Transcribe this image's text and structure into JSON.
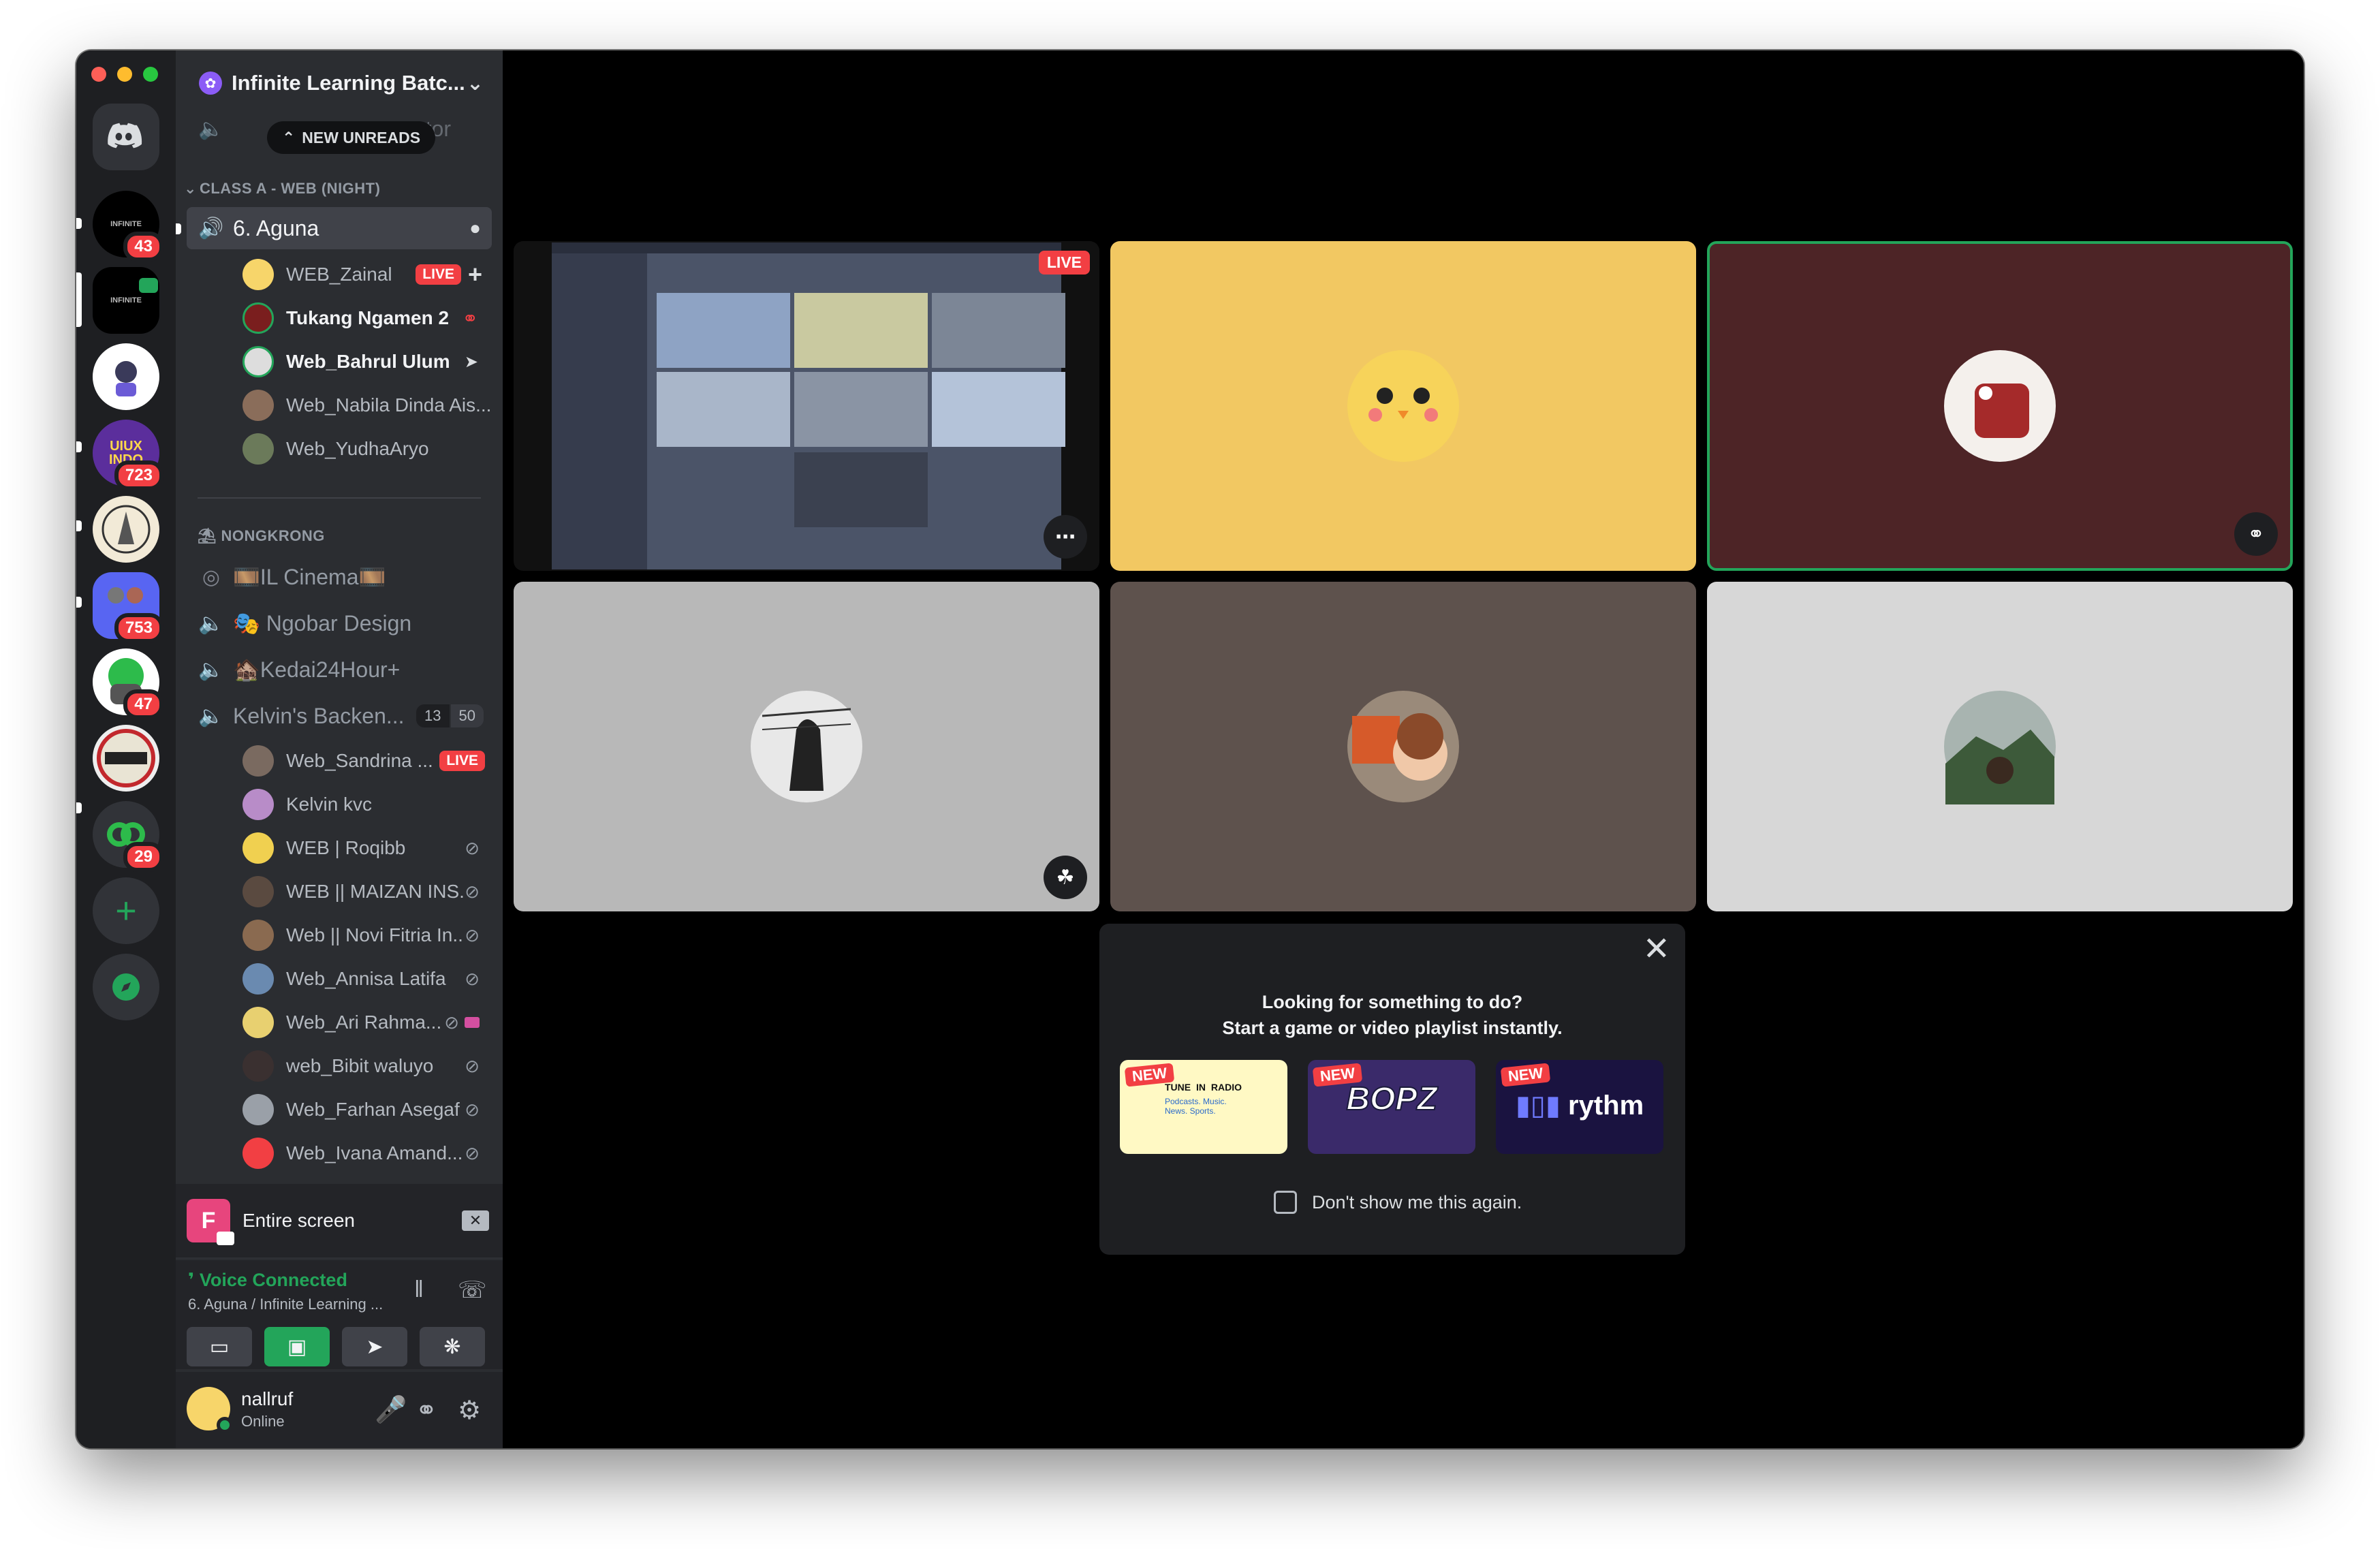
{
  "server": {
    "name": "Infinite Learning Batc...",
    "new_unreads": "NEW UNREADS",
    "hidden_channel_fragment": "ator"
  },
  "guild_badges": [
    "43",
    "723",
    "753",
    "47",
    "29"
  ],
  "guild_logo_texts": {
    "uiux": "UIUX INDO",
    "infinite": "INFINITE"
  },
  "categories": {
    "class_a": "CLASS A - WEB (NIGHT)",
    "nongkrong": "NONGKRONG"
  },
  "channels": {
    "aguna": "6. Aguna",
    "il_cinema": "🎞️IL Cinema🎞️",
    "ngobar": "🎭 Ngobar Design",
    "kedai": "🏚️Kedai24Hour+",
    "kelvin": "Kelvin's Backen...",
    "kelvin_count_a": "13",
    "kelvin_count_b": "50"
  },
  "aguna_users": [
    {
      "name": "WEB_Zainal",
      "live": "LIVE"
    },
    {
      "name": "Tukang Ngamen 2"
    },
    {
      "name": "Web_Bahrul Ulum"
    },
    {
      "name": "Web_Nabila Dinda Ais..."
    },
    {
      "name": "Web_YudhaAryo"
    }
  ],
  "kelvin_users": [
    {
      "name": "Web_Sandrina ...",
      "live": "LIVE"
    },
    {
      "name": "Kelvin kvc"
    },
    {
      "name": "WEB | Roqibb"
    },
    {
      "name": "WEB || MAIZAN INS..."
    },
    {
      "name": "Web || Novi Fitria In..."
    },
    {
      "name": "Web_Annisa Latifa"
    },
    {
      "name": "Web_Ari Rahma..."
    },
    {
      "name": "web_Bibit waluyo"
    },
    {
      "name": "Web_Farhan Asegaf"
    },
    {
      "name": "Web_Ivana Amand..."
    }
  ],
  "screen_share": {
    "initial": "F",
    "label": "Entire screen"
  },
  "voice": {
    "status": "Voice Connected",
    "location": "6. Aguna / Infinite Learning ..."
  },
  "me": {
    "name": "nallruf",
    "status": "Online"
  },
  "tiles": {
    "live_label": "LIVE"
  },
  "activity": {
    "line1": "Looking for something to do?",
    "line2": "Start a game or video playlist instantly.",
    "games": [
      {
        "tag": "NEW",
        "name": "TUNE IN RADIO",
        "sub": "Podcasts. Music. News. Sports."
      },
      {
        "tag": "NEW",
        "name": "BOPZ"
      },
      {
        "tag": "NEW",
        "name": "rythm"
      }
    ],
    "checkbox_label": "Don't show me this again."
  },
  "colors": {
    "accent_green": "#23a55a",
    "live_red": "#f23f43",
    "sidebar_bg": "#2b2d31",
    "rail_bg": "#1e1f22"
  },
  "icons": [
    "discord-logo-icon",
    "speaker-icon",
    "stage-icon",
    "chat-bubble-icon",
    "mic-muted-icon",
    "headphones-icon",
    "gear-icon",
    "close-icon",
    "phone-hangup-icon",
    "soundboard-icon",
    "rocket-icon",
    "camera-off-icon",
    "screen-share-icon",
    "plus-icon",
    "compass-icon"
  ]
}
